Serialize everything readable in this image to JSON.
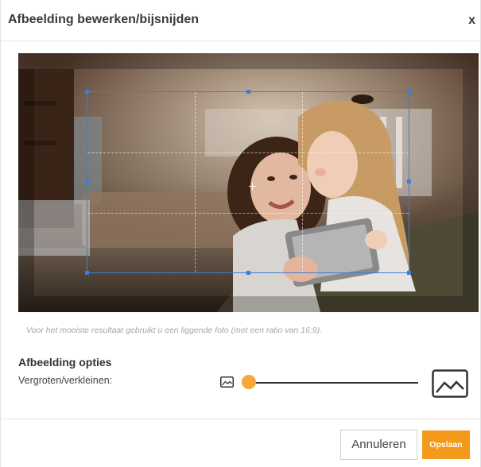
{
  "dialog": {
    "title": "Afbeelding bewerken/bijsnijden",
    "close_label": "x"
  },
  "editor": {
    "hint": "Voor het mooiste resultaat gebruikt u een liggende foto (met een ratio van 16:9)."
  },
  "options": {
    "title": "Afbeelding opties",
    "zoom_label": "Vergroten/verkleinen:",
    "zoom_value": 0.0,
    "small_icon": "image-small-icon",
    "large_icon": "image-large-icon",
    "thumb_color": "#f4a93a"
  },
  "footer": {
    "cancel_label": "Annuleren",
    "save_label": "Opslaan",
    "save_color": "#f39a1c"
  },
  "colors": {
    "crop_border": "#3b7ddd"
  }
}
